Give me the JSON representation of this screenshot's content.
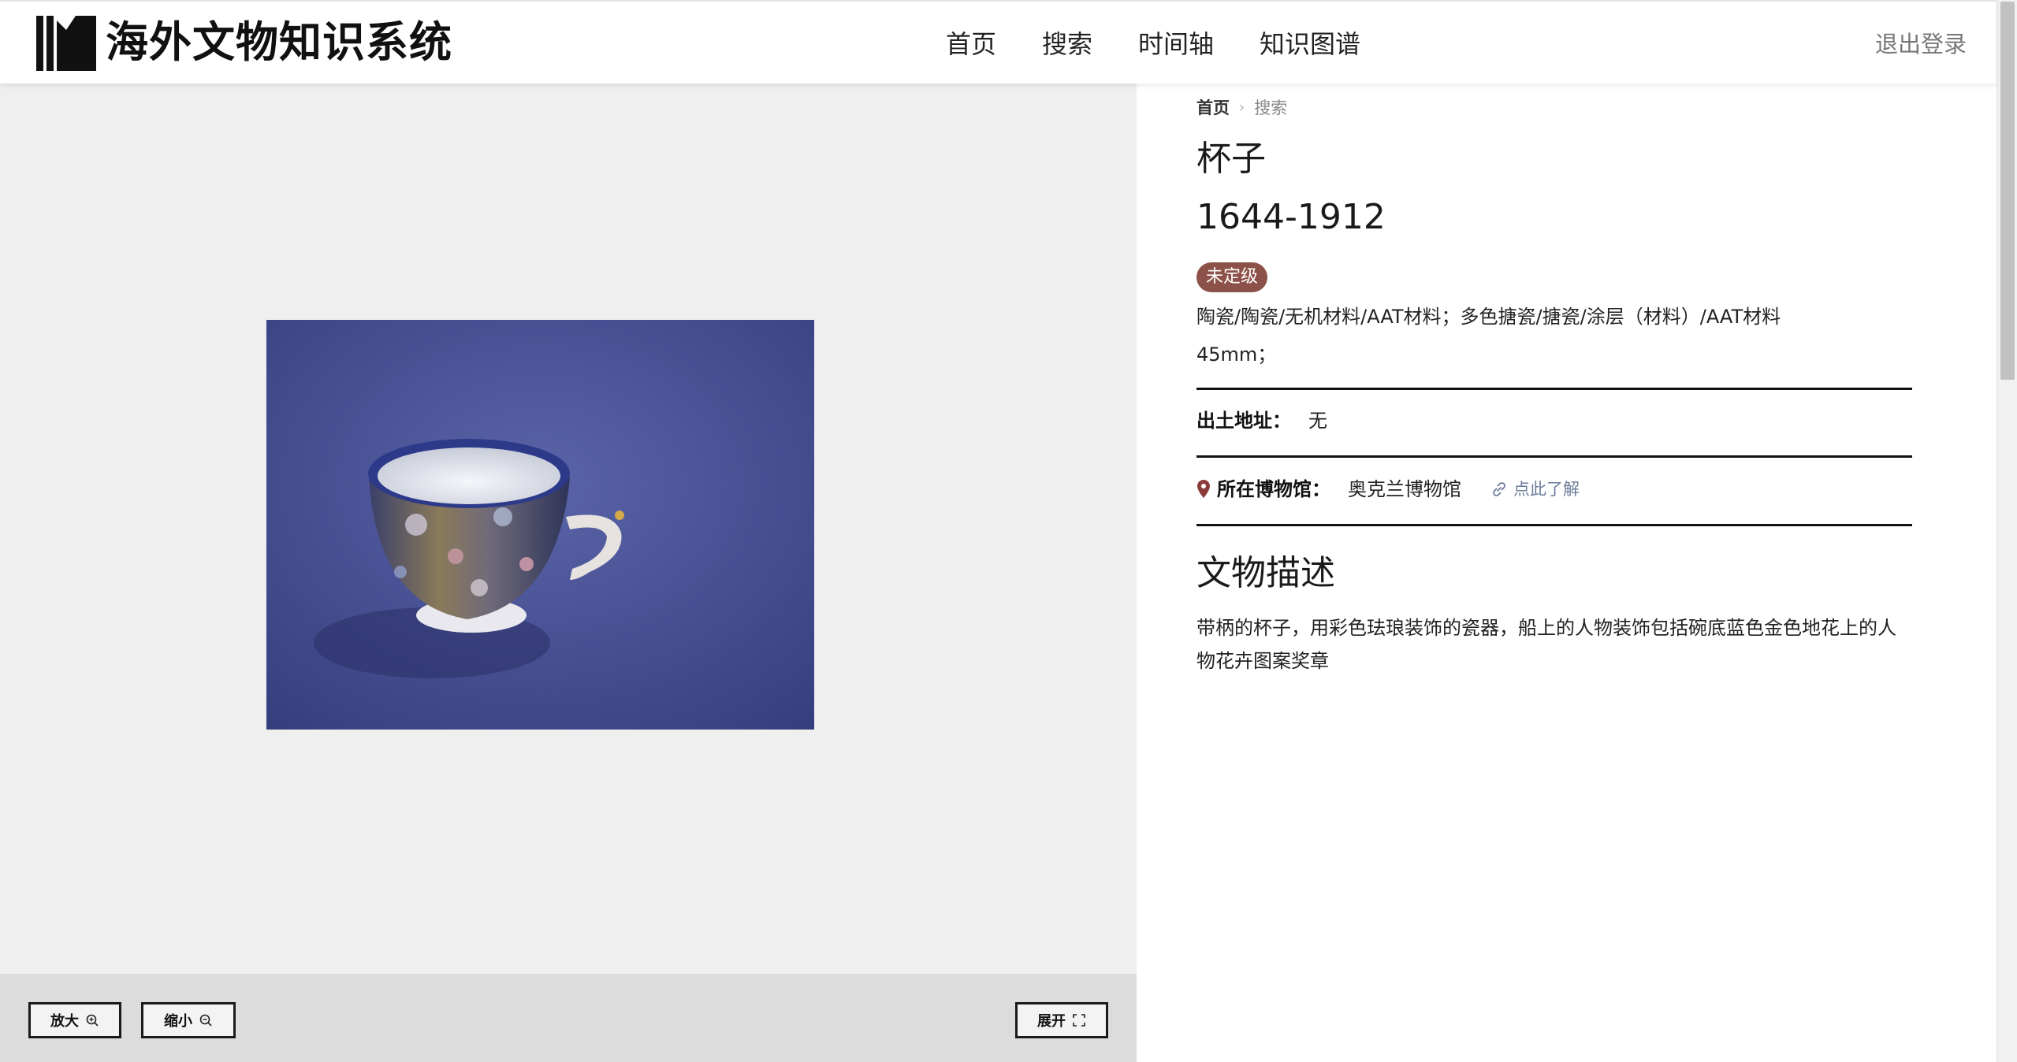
{
  "header": {
    "logo_text": "海外文物知识系统",
    "logo_icon": "bookshelf-logo-icon",
    "nav": [
      "首页",
      "搜索",
      "时间轴",
      "知识图谱"
    ],
    "logout": "退出登录"
  },
  "viewer": {
    "image_subject": "porcelain teacup",
    "buttons": {
      "zoom_in": "放大",
      "zoom_in_icon": "zoom-in-icon",
      "zoom_out": "缩小",
      "zoom_out_icon": "zoom-out-icon",
      "expand": "展开",
      "expand_icon": "expand-icon"
    }
  },
  "detail": {
    "breadcrumb": {
      "home": "首页",
      "separator_icon": "chevron-right-icon",
      "current": "搜索"
    },
    "title": "杯子",
    "dates": "1644-1912",
    "grade": "未定级",
    "materials": "陶瓷/陶瓷/无机材料/AAT材料；多色搪瓷/搪瓷/涂层（材料）/AAT材料",
    "dimensions": "45mm；",
    "excavation": {
      "label": "出土地址：",
      "value": "无"
    },
    "museum": {
      "label": "所在博物馆：",
      "value": "奥克兰博物馆",
      "pin_icon": "map-pin-icon",
      "link_text": "点此了解",
      "link_icon": "link-icon"
    },
    "description": {
      "heading": "文物描述",
      "text": "带柄的杯子，用彩色珐琅装饰的瓷器，船上的人物装饰包括碗底蓝色金色地花上的人物花卉图案奖章"
    }
  },
  "colors": {
    "badge": "#8c5148",
    "viewer_bg": "#efeff0",
    "toolbar_bg": "#dcdcdc",
    "link": "#6b7c99",
    "photo_backdrop": "#414a8c"
  }
}
